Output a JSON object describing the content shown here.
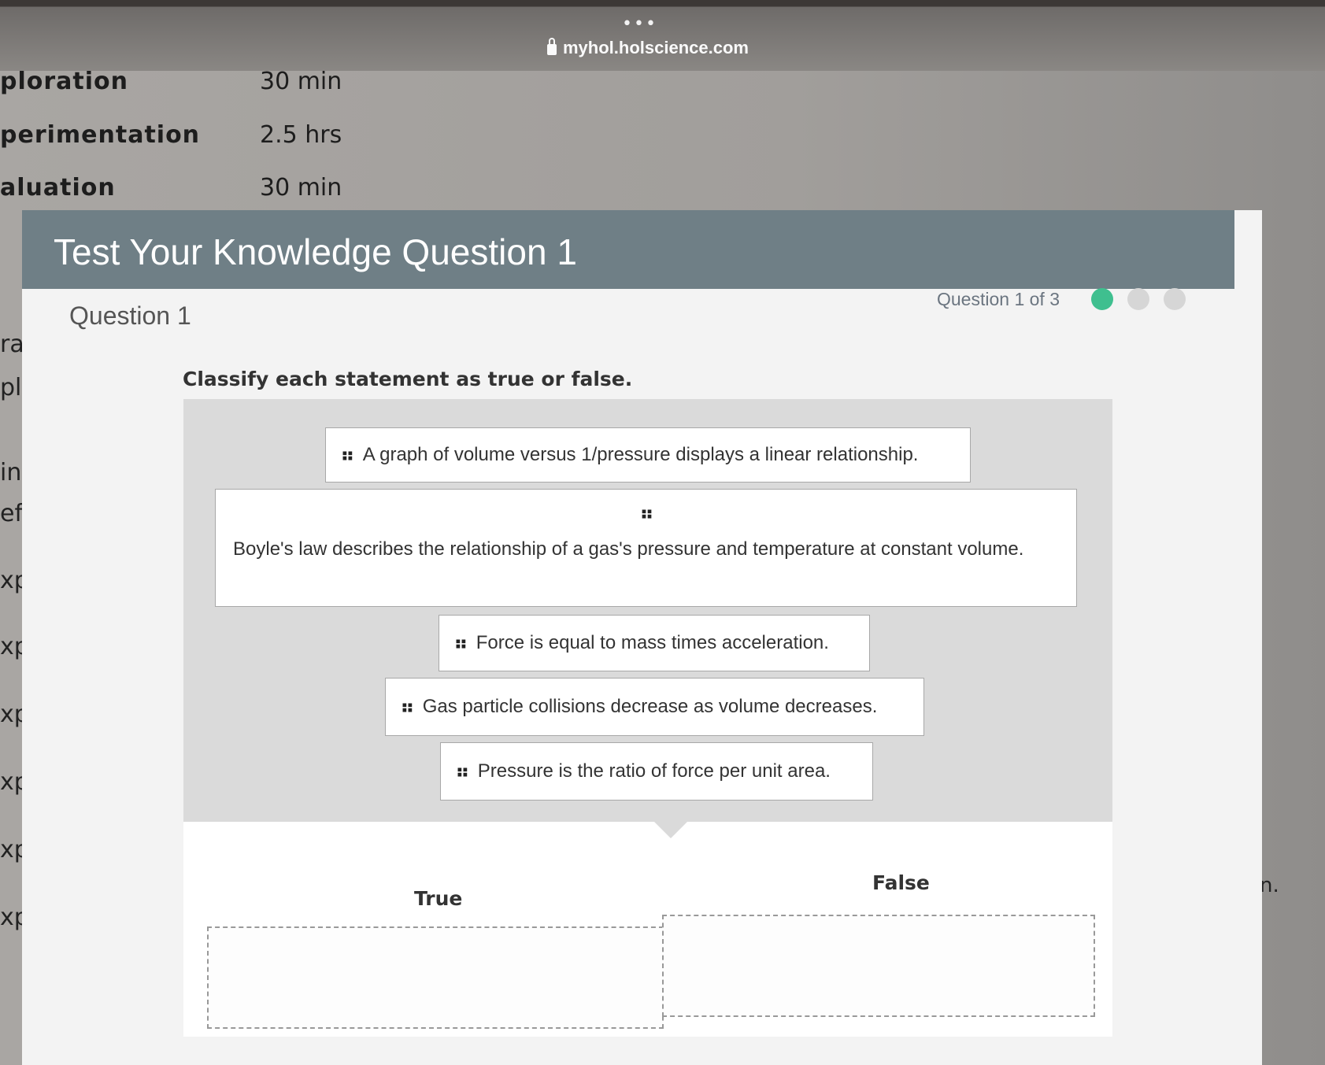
{
  "browser": {
    "menu_dots": "•••",
    "url": "myhol.holscience.com"
  },
  "background_page": {
    "schedule": [
      {
        "phase": "ploration",
        "time": "30 min"
      },
      {
        "phase": "perimentation",
        "time": "2.5 hrs"
      },
      {
        "phase": "aluation",
        "time": "30 min"
      }
    ],
    "left_fragments": [
      "ra",
      "pl",
      "in",
      "ef",
      "xp",
      "xp",
      "xp",
      "xp",
      "xp",
      "xp"
    ],
    "right_fragment": "n."
  },
  "modal": {
    "title": "Test Your Knowledge Question 1",
    "question_heading": "Question 1",
    "progress_text": "Question 1 of 3",
    "progress_dots": [
      {
        "state": "current",
        "color": "#3fbf8f"
      },
      {
        "state": "pending",
        "color": "#d6d6d6"
      },
      {
        "state": "pending",
        "color": "#d6d6d6"
      }
    ],
    "prompt": "Classify each statement as true or false.",
    "statements": [
      "A graph of volume versus 1/pressure displays a linear relationship.",
      "Boyle's law describes the relationship of a gas's pressure and temperature at constant volume.",
      "Force is equal to mass times acceleration.",
      "Gas particle collisions decrease as volume decreases.",
      "Pressure is the ratio of force per unit area."
    ],
    "buckets": [
      {
        "label": "True"
      },
      {
        "label": "False"
      }
    ]
  },
  "colors": {
    "header_bar": "#6f7f86",
    "progress_current": "#3fbf8f"
  }
}
